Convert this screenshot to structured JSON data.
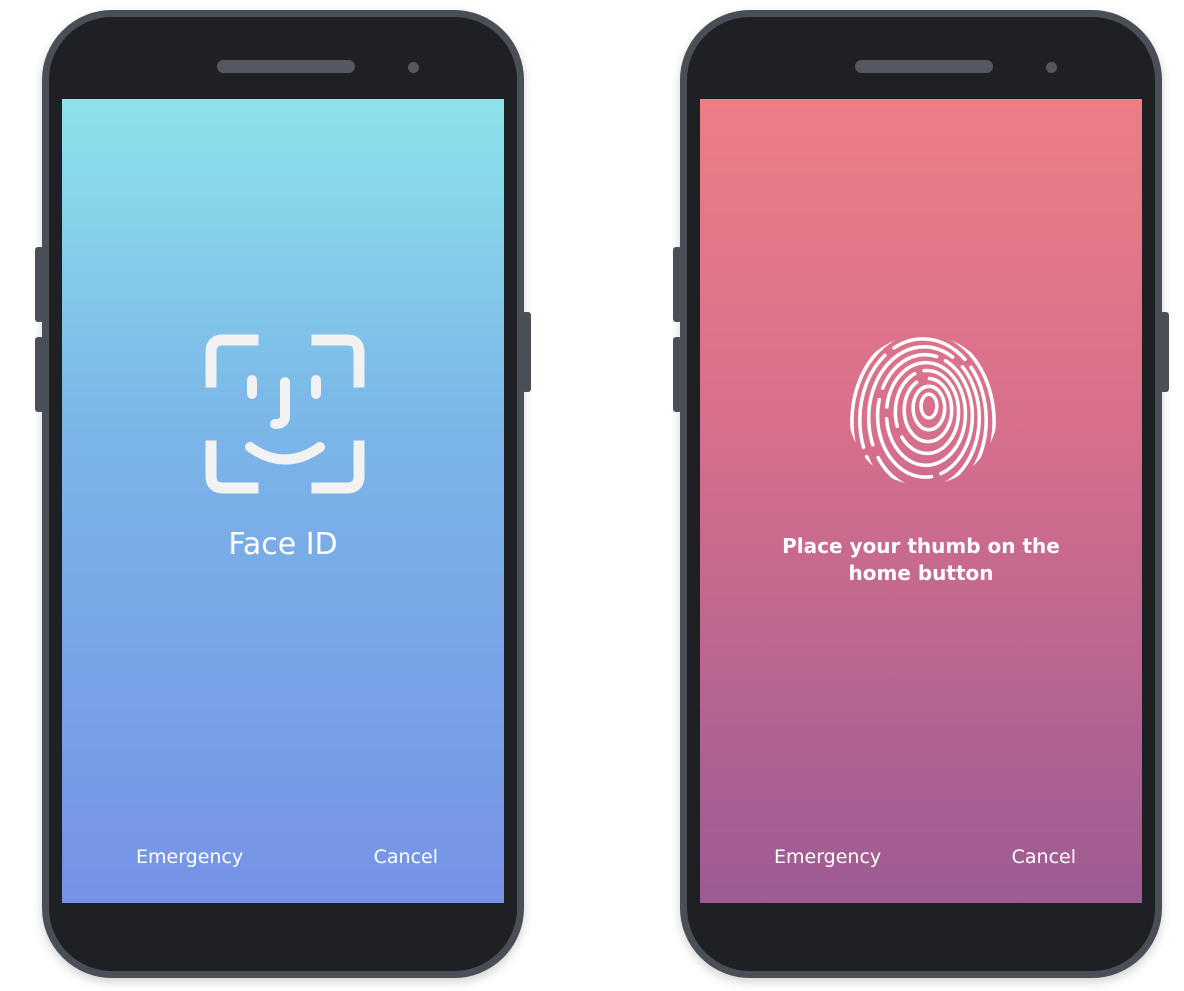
{
  "phones": [
    {
      "screen_label": "Face ID",
      "icon": "face-id-icon",
      "gradient": [
        "#8ce3ea",
        "#7bb6e8",
        "#7592e6"
      ],
      "emergency_label": "Emergency",
      "cancel_label": "Cancel"
    },
    {
      "screen_label": "Place your thumb on the home button",
      "icon": "fingerprint-icon",
      "gradient": [
        "#ee7d86",
        "#d36e8c",
        "#9d5b94"
      ],
      "emergency_label": "Emergency",
      "cancel_label": "Cancel"
    }
  ],
  "colors": {
    "phone_body": "#1f2023",
    "phone_frame": "#4a4f57",
    "text": "#ffffff"
  }
}
